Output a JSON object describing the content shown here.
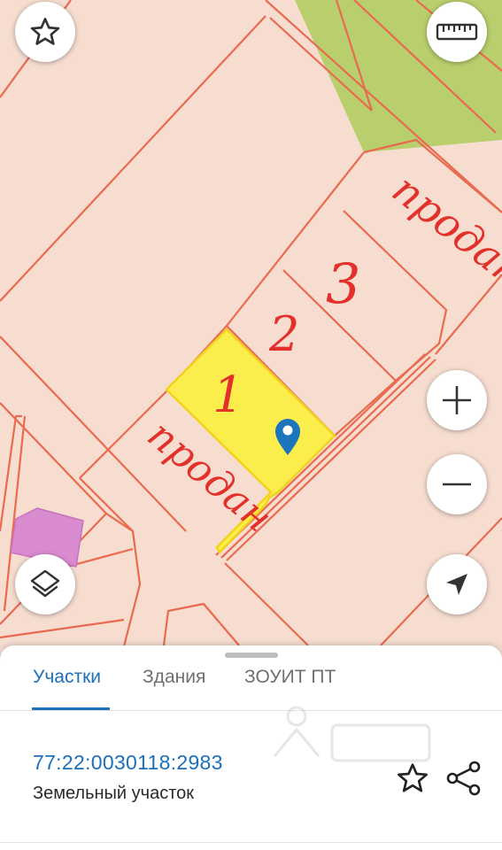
{
  "map": {
    "annotations": {
      "sold_top": "продан",
      "plot_3": "3",
      "plot_2": "2",
      "plot_1": "1",
      "sold_bottom": "продан"
    },
    "colors": {
      "background": "#f6ddd0",
      "boundary": "#e96a4f",
      "forest": "#b9cf6e",
      "selected_parcel": "#fbee4c",
      "building": "#d98bd0",
      "marker": "#1c75bc",
      "handwriting": "#e3302a"
    }
  },
  "buttons": {
    "favorite": {
      "icon": "star-outline-icon"
    },
    "ruler": {
      "icon": "ruler-icon"
    },
    "zoom_in": {
      "icon": "plus-icon"
    },
    "zoom_out": {
      "icon": "minus-icon"
    },
    "layers": {
      "icon": "layers-icon"
    },
    "my_location": {
      "icon": "navigation-arrow-icon"
    }
  },
  "sheet": {
    "tabs": [
      {
        "label": "Участки",
        "active": true
      },
      {
        "label": "Здания",
        "active": false
      },
      {
        "label": "ЗОУИТ ПТ",
        "active": false
      }
    ],
    "parcel": {
      "number": "77:22:0030118:2983",
      "type": "Земельный участок"
    },
    "actions": {
      "favorite_icon": "star-outline-icon",
      "share_icon": "share-icon"
    },
    "accent_color": "#1c6fb8"
  }
}
